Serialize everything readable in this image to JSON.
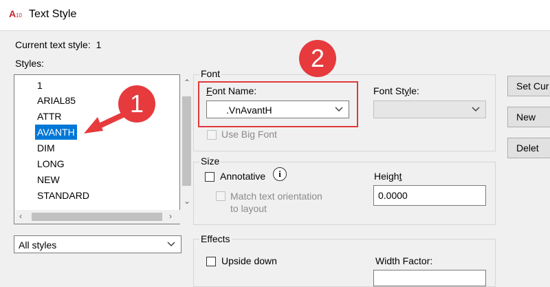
{
  "window": {
    "title": "Text Style",
    "app_icon_text": "A10"
  },
  "current_style": {
    "label": "Current text style:",
    "value": "1"
  },
  "styles": {
    "label": "Styles:",
    "items": [
      "1",
      "ARIAL85",
      "ATTR",
      "AVANTH",
      "DIM",
      "LONG",
      "NEW",
      "STANDARD"
    ],
    "selected": "AVANTH"
  },
  "filter_dropdown": {
    "value": "All styles"
  },
  "font_group": {
    "label": "Font",
    "font_name_label": "Font Name:",
    "font_name_value": ".VnAvantH",
    "font_style_label": "Font Style:",
    "font_style_value": "",
    "use_big_font_label": "Use Big Font"
  },
  "size_group": {
    "label": "Size",
    "annotative_label": "Annotative",
    "match_label_line1": "Match text orientation",
    "match_label_line2": "to layout",
    "height_label": "Height",
    "height_value": "0.0000"
  },
  "effects_group": {
    "label": "Effects",
    "upside_down_label": "Upside down",
    "width_factor_label": "Width Factor:"
  },
  "buttons": {
    "set_current": "Set Cur",
    "new": "New",
    "delete": "Delet"
  },
  "callouts": {
    "one": "1",
    "two": "2"
  },
  "colors": {
    "accent": "#0078d7",
    "callout": "#e63a3d"
  }
}
